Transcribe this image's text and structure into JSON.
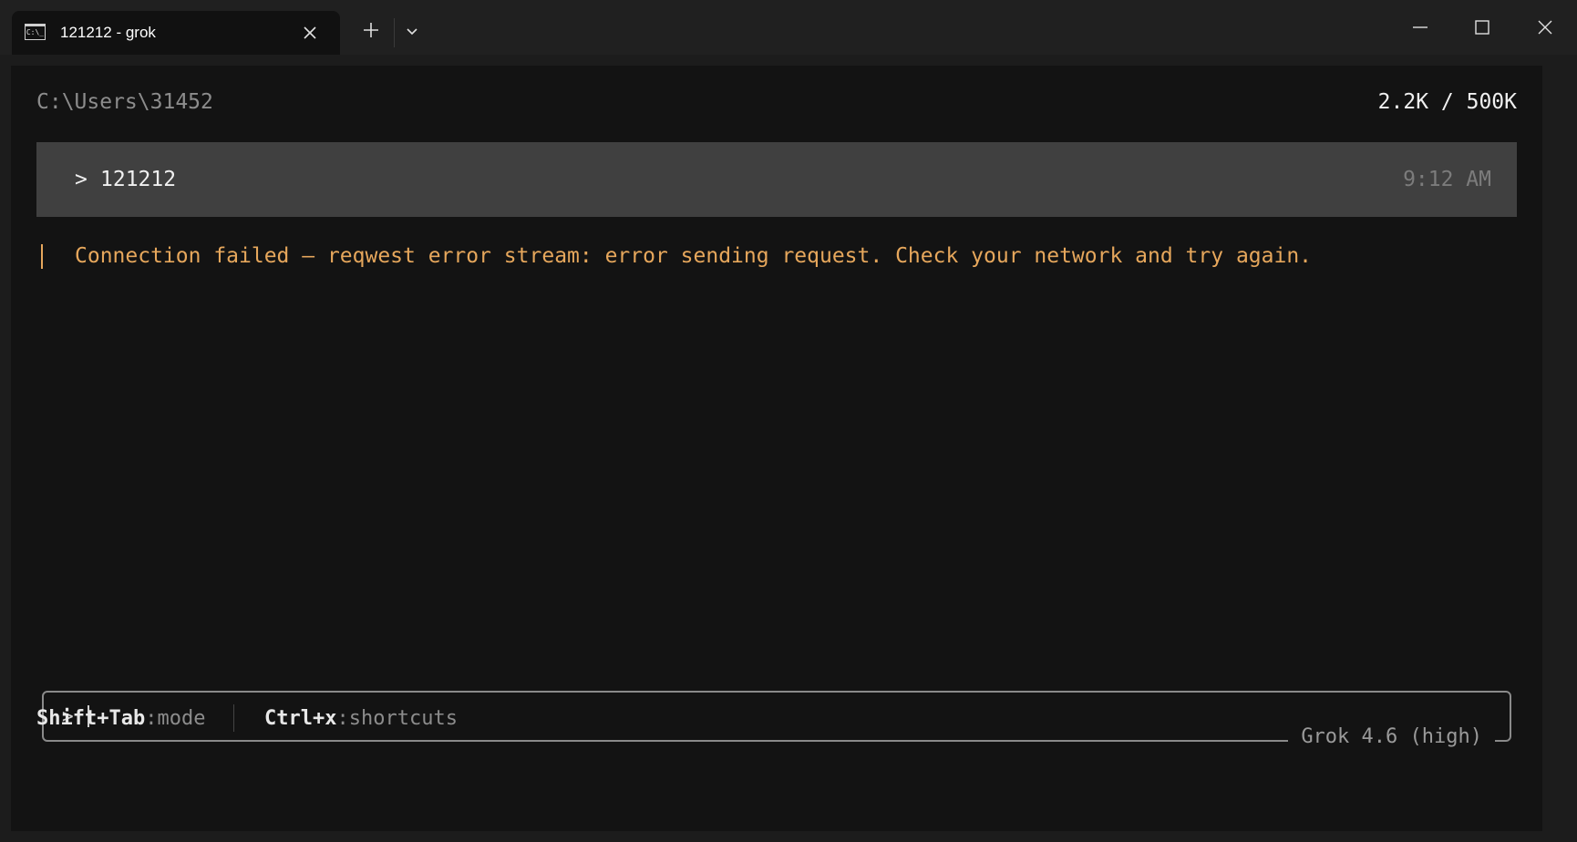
{
  "tab": {
    "icon": "terminal-icon",
    "icon_text": "C:\\_",
    "title": "121212 - grok"
  },
  "terminal": {
    "cwd": "C:\\Users\\31452",
    "tokens": "2.2K / 500K",
    "message": {
      "prompt": ">",
      "text": "121212",
      "time": "9:12 AM"
    },
    "error": "Connection failed — reqwest error stream: error sending request. Check your network and try again.",
    "input": {
      "prompt": ">",
      "value": "",
      "model": "Grok 4.6 (high)"
    },
    "footer": {
      "mode_key": "Shift+Tab",
      "mode_desc": ":mode",
      "shortcuts_key": "Ctrl+x",
      "shortcuts_desc": ":shortcuts"
    }
  },
  "colors": {
    "error": "#e6a75c",
    "message_bg": "#404040",
    "terminal_bg": "#131313"
  }
}
